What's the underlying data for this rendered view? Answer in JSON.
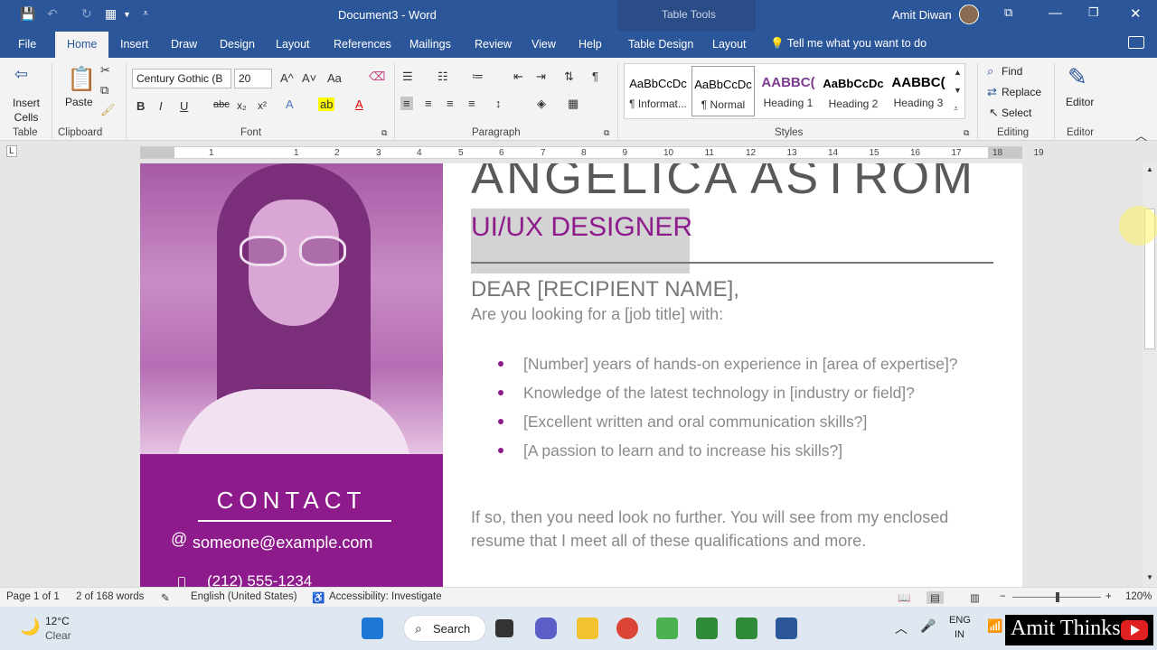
{
  "titlebar": {
    "doc_title": "Document3 - Word",
    "context_tools": "Table Tools",
    "user": "Amit Diwan",
    "icons": [
      "save-icon",
      "undo-icon",
      "redo-icon",
      "table-icon",
      "customize-qat-icon",
      "ribbon-display-icon",
      "minimize-icon",
      "restore-icon",
      "close-icon"
    ]
  },
  "tabs": [
    "File",
    "Home",
    "Insert",
    "Draw",
    "Design",
    "Layout",
    "References",
    "Mailings",
    "Review",
    "View",
    "Help",
    "Table Design",
    "Layout"
  ],
  "active_tab": "Home",
  "tellme": "Tell me what you want to do",
  "ribbon": {
    "table_group": {
      "button": "Insert Cells",
      "label": "Table"
    },
    "clipboard": {
      "paste": "Paste",
      "label": "Clipboard"
    },
    "font": {
      "family": "Century Gothic (B",
      "size": "20",
      "label": "Font",
      "bold": "B",
      "italic": "I",
      "underline": "U",
      "strike": "abc",
      "sub": "x₂",
      "sup": "x²",
      "grow": "A^",
      "shrink": "A˅",
      "case": "Aa",
      "font_color_hex": "#e00000",
      "highlight_hex": "#ffff00"
    },
    "paragraph": {
      "label": "Paragraph"
    },
    "styles": {
      "label": "Styles",
      "items": [
        {
          "preview": "AaBbCcDc",
          "name": "¶ Informat..."
        },
        {
          "preview": "AaBbCcDc",
          "name": "¶ Normal"
        },
        {
          "preview": "AABBC(",
          "name": "Heading 1"
        },
        {
          "preview": "AaBbCcDc",
          "name": "Heading 2"
        },
        {
          "preview": "AABBC(",
          "name": "Heading 3"
        }
      ],
      "heading1_color": "#7a3b8f"
    },
    "editing": {
      "find": "Find",
      "replace": "Replace",
      "select": "Select",
      "label": "Editing"
    },
    "editor": {
      "button": "Editor",
      "label": "Editor"
    }
  },
  "ruler_numbers": [
    "1",
    "1",
    "2",
    "3",
    "4",
    "5",
    "6",
    "7",
    "8",
    "9",
    "10",
    "11",
    "12",
    "13",
    "14",
    "15",
    "16",
    "17",
    "18",
    "19"
  ],
  "document": {
    "name": "ANGELICA ASTROM",
    "role": "UI/UX DESIGNER",
    "salutation": "DEAR [RECIPIENT NAME],",
    "intro": "Are you looking for a [job title] with:",
    "bullets": [
      "[Number] years of hands-on experience in [area of expertise]?",
      "Knowledge of the latest technology in [industry or field]?",
      "[Excellent written and oral communication skills?]",
      "[A passion to learn and to increase his skills?]"
    ],
    "closing": "If so, then you need look no further. You will see from my enclosed resume that I meet all of these qualifications and more.",
    "contact": {
      "title": "CONTACT",
      "at": "@",
      "email": "someone@example.com",
      "phone": "(212) 555-1234"
    },
    "accent_hex": "#8e1b8c"
  },
  "status": {
    "page": "Page 1 of 1",
    "words": "2 of 168 words",
    "language": "English (United States)",
    "accessibility": "Accessibility: Investigate",
    "zoom": "120%",
    "zoom_minus": "−",
    "zoom_plus": "+"
  },
  "taskbar": {
    "temp": "12°C",
    "condition": "Clear",
    "search": "Search",
    "lang1": "ENG",
    "lang2": "IN"
  },
  "brand": "Amit Thinks"
}
